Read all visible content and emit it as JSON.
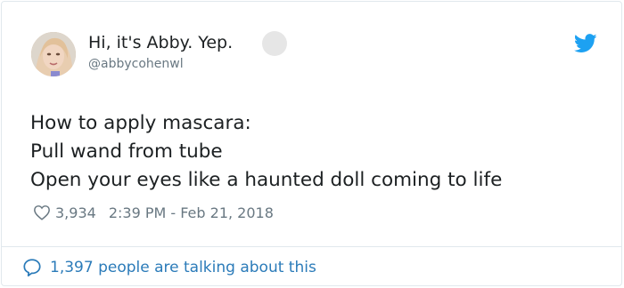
{
  "user": {
    "display_name": "Hi, it's Abby. Yep.",
    "handle": "@abbycohenwl"
  },
  "tweet": {
    "lines": [
      "How to apply mascara:",
      "Pull wand from tube",
      "Open your eyes like a haunted doll coming to life"
    ],
    "likes": "3,934",
    "timestamp": "2:39 PM - Feb 21, 2018"
  },
  "footer": {
    "talking_text": "1,397 people are talking about this"
  },
  "icons": {
    "brand": "twitter-bird-icon",
    "like": "heart-icon",
    "reply": "speech-bubble-icon"
  },
  "colors": {
    "twitter_blue": "#1da1f2",
    "link_blue": "#2b7bb9",
    "muted_text": "#697882",
    "border": "#e1e8ed"
  }
}
